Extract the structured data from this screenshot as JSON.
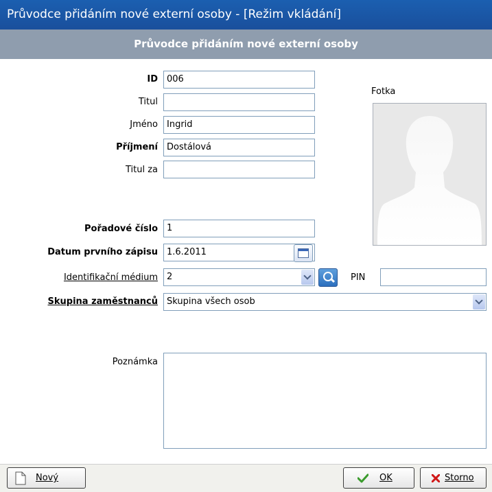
{
  "window": {
    "title": "Průvodce přidáním nové externí osoby - [Režim vkládání]"
  },
  "header": {
    "title": "Průvodce přidáním nové externí osoby"
  },
  "form": {
    "id": {
      "label": "ID",
      "value": "006"
    },
    "titul": {
      "label": "Titul",
      "value": ""
    },
    "jmeno": {
      "label": "Jméno",
      "value": "Ingrid"
    },
    "prijmeni": {
      "label": "Příjmení",
      "value": "Dostálová"
    },
    "titul_za": {
      "label": "Titul za",
      "value": ""
    },
    "poradove_cislo": {
      "label": "Pořadové číslo",
      "value": "1"
    },
    "datum": {
      "label": "Datum prvního zápisu",
      "value": "1.6.2011"
    },
    "medium": {
      "label": "Identifikační médium",
      "value": "2"
    },
    "pin": {
      "label": "PIN",
      "value": ""
    },
    "skupina": {
      "label": "Skupina zaměstnanců",
      "value": "Skupina všech osob"
    },
    "poznamka": {
      "label": "Poznámka",
      "value": ""
    }
  },
  "photo": {
    "label": "Fotka"
  },
  "buttons": {
    "new_label": "Nový",
    "ok_label": "OK",
    "cancel_label": "Storno"
  },
  "colors": {
    "titlebar": "#1a56a6",
    "header": "#8f9dae",
    "field_border": "#7f9db9"
  }
}
